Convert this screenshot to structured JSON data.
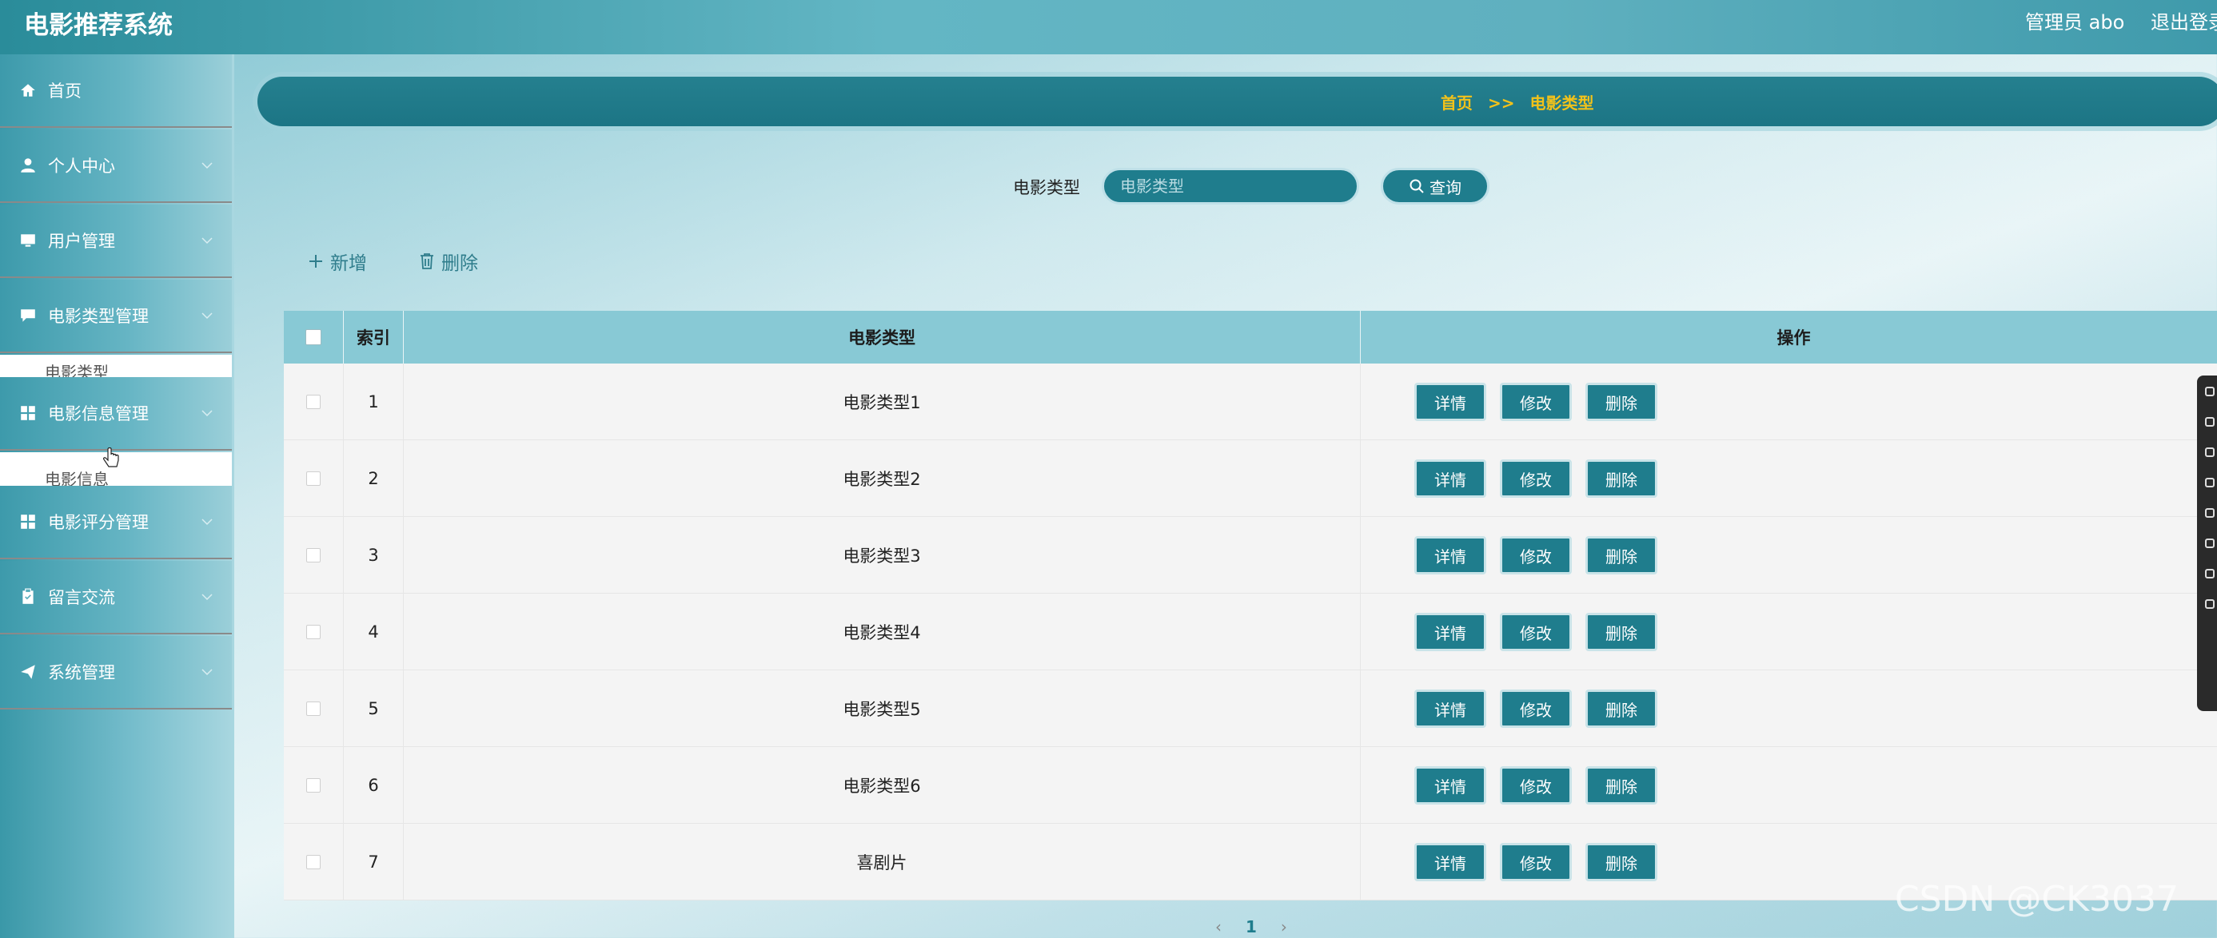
{
  "header": {
    "app_title": "电影推荐系统",
    "admin_label": "管理员 abo",
    "logout_label": "退出登录"
  },
  "sidebar": {
    "items": [
      {
        "label": "首页",
        "icon": "home-icon"
      },
      {
        "label": "个人中心",
        "icon": "user-icon"
      },
      {
        "label": "用户管理",
        "icon": "monitor-icon"
      },
      {
        "label": "电影类型管理",
        "icon": "chat-icon"
      },
      {
        "label": "电影信息管理",
        "icon": "grid-icon"
      },
      {
        "label": "电影评分管理",
        "icon": "grid-icon"
      },
      {
        "label": "留言交流",
        "icon": "clipboard-icon"
      },
      {
        "label": "系统管理",
        "icon": "send-icon"
      }
    ],
    "submenus": [
      {
        "label": "电影类型"
      },
      {
        "label": "电影信息"
      }
    ]
  },
  "breadcrumb": {
    "home": "首页",
    "separator": ">>",
    "current": "电影类型"
  },
  "search": {
    "label": "电影类型",
    "placeholder": "电影类型",
    "button_label": "查询"
  },
  "actions": {
    "add_label": "新增",
    "delete_label": "删除"
  },
  "table": {
    "columns": [
      "索引",
      "电影类型",
      "操作"
    ],
    "rows": [
      {
        "index": "1",
        "type": "电影类型1"
      },
      {
        "index": "2",
        "type": "电影类型2"
      },
      {
        "index": "3",
        "type": "电影类型3"
      },
      {
        "index": "4",
        "type": "电影类型4"
      },
      {
        "index": "5",
        "type": "电影类型5"
      },
      {
        "index": "6",
        "type": "电影类型6"
      },
      {
        "index": "7",
        "type": "喜剧片"
      }
    ],
    "row_buttons": {
      "detail": "详情",
      "edit": "修改",
      "delete": "删除"
    }
  },
  "pagination": {
    "prev": "‹",
    "current": "1",
    "next": "›"
  },
  "watermark": "CSDN @CK3037",
  "colors": {
    "accent": "#1f7d8d",
    "header_row": "#88c9d5",
    "breadcrumb_text": "#f2c21a"
  }
}
